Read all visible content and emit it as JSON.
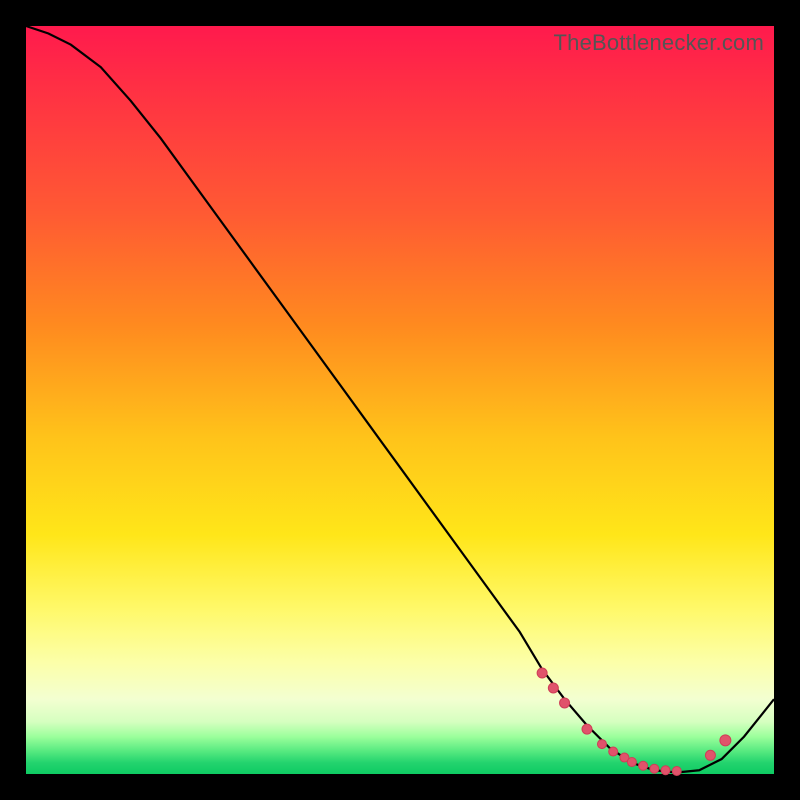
{
  "watermark": "TheBottlenecker.com",
  "colors": {
    "top": "#ff1a4d",
    "mid": "#ffe619",
    "bottom": "#0ecb63",
    "curve": "#000000",
    "dots": "#e0536b",
    "frame": "#000000"
  },
  "chart_data": {
    "type": "line",
    "title": "",
    "xlabel": "",
    "ylabel": "",
    "xlim": [
      0,
      100
    ],
    "ylim": [
      0,
      100
    ],
    "grid": false,
    "legend": false,
    "series": [
      {
        "name": "bottleneck-curve",
        "x": [
          0,
          3,
          6,
          10,
          14,
          18,
          22,
          26,
          30,
          34,
          38,
          42,
          46,
          50,
          54,
          58,
          62,
          66,
          69,
          72,
          75,
          78,
          81,
          84,
          87,
          90,
          93,
          96,
          100
        ],
        "y": [
          100,
          99,
          97.5,
          94.5,
          90,
          85,
          79.5,
          74,
          68.5,
          63,
          57.5,
          52,
          46.5,
          41,
          35.5,
          30,
          24.5,
          19,
          14,
          10,
          6.5,
          3.5,
          1.5,
          0.5,
          0.2,
          0.5,
          2,
          5,
          10
        ]
      }
    ],
    "markers": {
      "name": "highlight-dots",
      "x": [
        69,
        70.5,
        72,
        75,
        77,
        78.5,
        80,
        81,
        82.5,
        84,
        85.5,
        87,
        91.5,
        93.5
      ],
      "y": [
        13.5,
        11.5,
        9.5,
        6,
        4,
        3,
        2.2,
        1.6,
        1.1,
        0.7,
        0.5,
        0.4,
        2.5,
        4.5
      ],
      "r": [
        5,
        5,
        5,
        5,
        4.5,
        4.5,
        4.5,
        4.5,
        4.5,
        4.5,
        4.5,
        4.5,
        5,
        5.5
      ]
    }
  }
}
